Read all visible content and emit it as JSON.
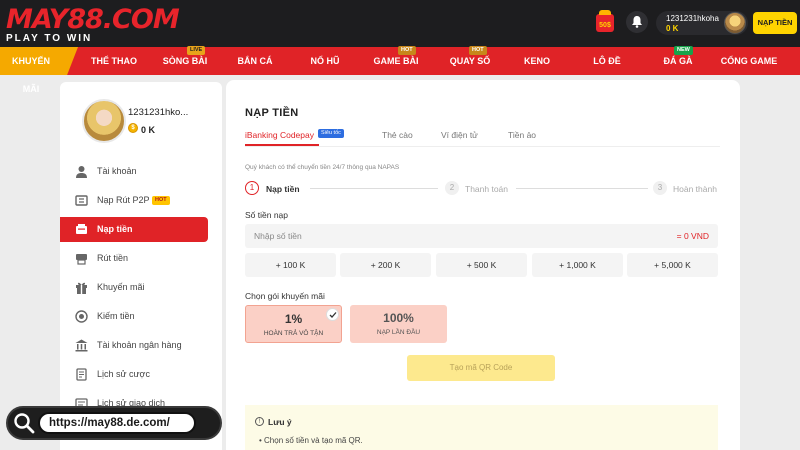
{
  "brand": {
    "logo_main": "MAY88.COM",
    "logo_tagline": "PLAY TO WIN",
    "colors": {
      "red": "#e02327",
      "yellow": "#ffd400",
      "dark": "#1d1d1f",
      "orange": "#f5a900"
    }
  },
  "header": {
    "gift_badge_text": "50$",
    "username": "1231231hkoha",
    "balance": "0 K",
    "deposit_button": "NẠP TIỀN"
  },
  "nav": {
    "items": [
      {
        "label": "KHUYẾN MÃI",
        "badge": ""
      },
      {
        "label": "THỂ THAO",
        "badge": ""
      },
      {
        "label": "SÒNG BÀI",
        "badge": "LIVE"
      },
      {
        "label": "BẮN CÁ",
        "badge": ""
      },
      {
        "label": "NỔ HŨ",
        "badge": ""
      },
      {
        "label": "GAME BÀI",
        "badge": "HOT"
      },
      {
        "label": "QUAY SỐ",
        "badge": "HOT"
      },
      {
        "label": "KENO",
        "badge": ""
      },
      {
        "label": "LÔ ĐỀ",
        "badge": ""
      },
      {
        "label": "ĐÁ GÀ",
        "badge": "NEW"
      },
      {
        "label": "CỔNG GAME",
        "badge": ""
      }
    ]
  },
  "sidebar": {
    "profile_name": "1231231hko...",
    "balance": "0 K",
    "items": [
      {
        "label": "Tài khoản",
        "icon": "user-icon"
      },
      {
        "label": "Nạp Rút P2P",
        "icon": "p2p-icon",
        "badge": "HOT"
      },
      {
        "label": "Nạp tiền",
        "icon": "deposit-icon",
        "active": true
      },
      {
        "label": "Rút tiền",
        "icon": "withdraw-icon"
      },
      {
        "label": "Khuyến mãi",
        "icon": "gift-icon"
      },
      {
        "label": "Kiếm tiền",
        "icon": "coin-icon"
      },
      {
        "label": "Tài khoản ngân hàng",
        "icon": "bank-icon"
      },
      {
        "label": "Lịch sử cược",
        "icon": "history-icon"
      },
      {
        "label": "Lịch sử giao dịch",
        "icon": "transaction-icon"
      }
    ]
  },
  "main": {
    "title": "NẠP TIỀN",
    "tabs": [
      {
        "label": "iBanking Codepay",
        "badge": "Siêu tốc",
        "active": true
      },
      {
        "label": "Thẻ cào"
      },
      {
        "label": "Ví điện tử"
      },
      {
        "label": "Tiền ảo"
      }
    ],
    "info_note": "Quý khách có thể chuyển tiền 24/7 thông qua NAPAS",
    "steps": [
      {
        "num": "1",
        "label": "Nạp tiền",
        "active": true
      },
      {
        "num": "2",
        "label": "Thanh toán"
      },
      {
        "num": "3",
        "label": "Hoàn thành"
      }
    ],
    "amount_label": "Số tiền nạp",
    "amount_placeholder": "Nhập số tiền",
    "amount_converted": "= 0 VND",
    "quick_amounts": [
      "+ 100 K",
      "+ 200 K",
      "+ 500 K",
      "+ 1,000 K",
      "+ 5,000 K"
    ],
    "promo_label": "Chọn gói khuyến mãi",
    "promos": [
      {
        "value": "1%",
        "subtitle": "HOÀN TRẢ VÔ TẬN",
        "selected": true
      },
      {
        "value": "100%",
        "subtitle": "NẠP LẦN ĐẦU",
        "selected": false
      }
    ],
    "qr_button": "Tạo mã QR Code",
    "note_title": "Lưu ý",
    "note_items": [
      "Chọn số tiền và tạo mã QR."
    ]
  },
  "watermark": {
    "url": "https://may88.de.com/"
  }
}
